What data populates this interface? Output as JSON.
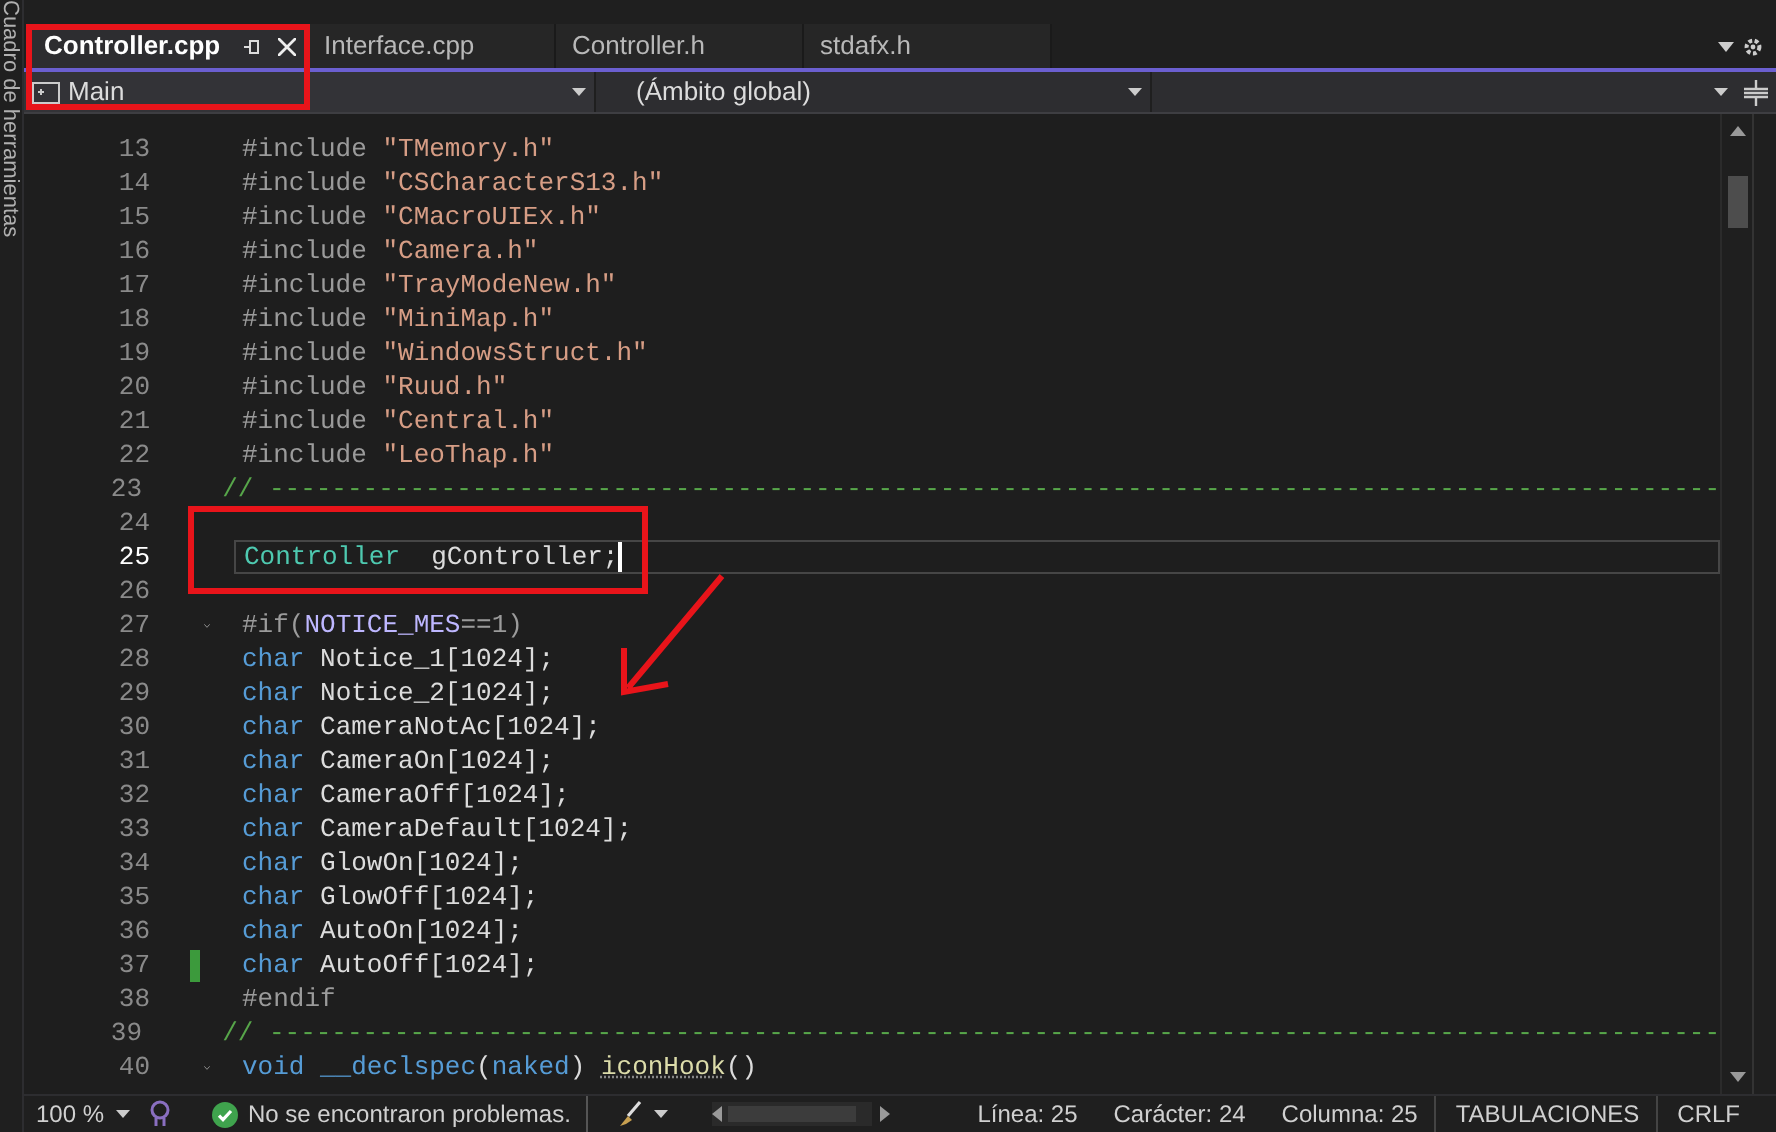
{
  "side_panel": {
    "label": "Cuadro de herramientas"
  },
  "tabs": [
    {
      "label": "Controller.cpp",
      "selected": true
    },
    {
      "label": "Interface.cpp",
      "selected": false
    },
    {
      "label": "Controller.h",
      "selected": false
    },
    {
      "label": "stdafx.h",
      "selected": false
    }
  ],
  "nav_bar": {
    "project": "Main",
    "scope": "(Ámbito global)"
  },
  "code_lines": [
    {
      "number": "13",
      "current": false,
      "foldable": false,
      "changed": false,
      "tokens": [
        {
          "kind": "preproc",
          "text": "#include "
        },
        {
          "kind": "string",
          "text": "\"TMemory.h\""
        }
      ]
    },
    {
      "number": "14",
      "current": false,
      "foldable": false,
      "changed": false,
      "tokens": [
        {
          "kind": "preproc",
          "text": "#include "
        },
        {
          "kind": "string",
          "text": "\"CSCharacterS13.h\""
        }
      ]
    },
    {
      "number": "15",
      "current": false,
      "foldable": false,
      "changed": false,
      "tokens": [
        {
          "kind": "preproc",
          "text": "#include "
        },
        {
          "kind": "string",
          "text": "\"CMacroUIEx.h\""
        }
      ]
    },
    {
      "number": "16",
      "current": false,
      "foldable": false,
      "changed": false,
      "tokens": [
        {
          "kind": "preproc",
          "text": "#include "
        },
        {
          "kind": "string",
          "text": "\"Camera.h\""
        }
      ]
    },
    {
      "number": "17",
      "current": false,
      "foldable": false,
      "changed": false,
      "tokens": [
        {
          "kind": "preproc",
          "text": "#include "
        },
        {
          "kind": "string",
          "text": "\"TrayModeNew.h\""
        }
      ]
    },
    {
      "number": "18",
      "current": false,
      "foldable": false,
      "changed": false,
      "tokens": [
        {
          "kind": "preproc",
          "text": "#include "
        },
        {
          "kind": "string",
          "text": "\"MiniMap.h\""
        }
      ]
    },
    {
      "number": "19",
      "current": false,
      "foldable": false,
      "changed": false,
      "tokens": [
        {
          "kind": "preproc",
          "text": "#include "
        },
        {
          "kind": "string",
          "text": "\"WindowsStruct.h\""
        }
      ]
    },
    {
      "number": "20",
      "current": false,
      "foldable": false,
      "changed": false,
      "tokens": [
        {
          "kind": "preproc",
          "text": "#include "
        },
        {
          "kind": "string",
          "text": "\"Ruud.h\""
        }
      ]
    },
    {
      "number": "21",
      "current": false,
      "foldable": false,
      "changed": false,
      "tokens": [
        {
          "kind": "preproc",
          "text": "#include "
        },
        {
          "kind": "string",
          "text": "\"Central.h\""
        }
      ]
    },
    {
      "number": "22",
      "current": false,
      "foldable": false,
      "changed": false,
      "tokens": [
        {
          "kind": "preproc",
          "text": "#include "
        },
        {
          "kind": "string",
          "text": "\"LeoThap.h\""
        }
      ]
    },
    {
      "number": "23",
      "current": false,
      "foldable": false,
      "changed": false,
      "tokens": [
        {
          "kind": "comment",
          "text": "// ---------------------------------------------------------------------------------------------"
        }
      ]
    },
    {
      "number": "24",
      "current": false,
      "foldable": false,
      "changed": false
    },
    {
      "number": "25",
      "current": true,
      "foldable": false,
      "changed": false,
      "tokens": [
        {
          "kind": "type",
          "text": "Controller"
        },
        {
          "kind": "plain",
          "text": "  gController;"
        }
      ]
    },
    {
      "number": "26",
      "current": false,
      "foldable": false,
      "changed": false
    },
    {
      "number": "27",
      "current": false,
      "foldable": true,
      "changed": false,
      "tokens": [
        {
          "kind": "preproc",
          "text": "#if("
        },
        {
          "kind": "macro",
          "text": "NOTICE_MES"
        },
        {
          "kind": "preproc",
          "text": "==1)"
        }
      ]
    },
    {
      "number": "28",
      "current": false,
      "foldable": false,
      "changed": false,
      "tokens": [
        {
          "kind": "keyword",
          "text": "char"
        },
        {
          "kind": "plain",
          "text": " Notice_1[1024];"
        }
      ]
    },
    {
      "number": "29",
      "current": false,
      "foldable": false,
      "changed": false,
      "tokens": [
        {
          "kind": "keyword",
          "text": "char"
        },
        {
          "kind": "plain",
          "text": " Notice_2[1024];"
        }
      ]
    },
    {
      "number": "30",
      "current": false,
      "foldable": false,
      "changed": false,
      "tokens": [
        {
          "kind": "keyword",
          "text": "char"
        },
        {
          "kind": "plain",
          "text": " CameraNotAc[1024];"
        }
      ]
    },
    {
      "number": "31",
      "current": false,
      "foldable": false,
      "changed": false,
      "tokens": [
        {
          "kind": "keyword",
          "text": "char"
        },
        {
          "kind": "plain",
          "text": " CameraOn[1024];"
        }
      ]
    },
    {
      "number": "32",
      "current": false,
      "foldable": false,
      "changed": false,
      "tokens": [
        {
          "kind": "keyword",
          "text": "char"
        },
        {
          "kind": "plain",
          "text": " CameraOff[1024];"
        }
      ]
    },
    {
      "number": "33",
      "current": false,
      "foldable": false,
      "changed": false,
      "tokens": [
        {
          "kind": "keyword",
          "text": "char"
        },
        {
          "kind": "plain",
          "text": " CameraDefault[1024];"
        }
      ]
    },
    {
      "number": "34",
      "current": false,
      "foldable": false,
      "changed": false,
      "tokens": [
        {
          "kind": "keyword",
          "text": "char"
        },
        {
          "kind": "plain",
          "text": " GlowOn[1024];"
        }
      ]
    },
    {
      "number": "35",
      "current": false,
      "foldable": false,
      "changed": false,
      "tokens": [
        {
          "kind": "keyword",
          "text": "char"
        },
        {
          "kind": "plain",
          "text": " GlowOff[1024];"
        }
      ]
    },
    {
      "number": "36",
      "current": false,
      "foldable": false,
      "changed": false,
      "tokens": [
        {
          "kind": "keyword",
          "text": "char"
        },
        {
          "kind": "plain",
          "text": " AutoOn[1024];"
        }
      ]
    },
    {
      "number": "37",
      "current": false,
      "foldable": false,
      "changed": true,
      "tokens": [
        {
          "kind": "keyword",
          "text": "char"
        },
        {
          "kind": "plain",
          "text": " AutoOff[1024];"
        }
      ]
    },
    {
      "number": "38",
      "current": false,
      "foldable": false,
      "changed": false,
      "tokens": [
        {
          "kind": "preproc",
          "text": "#endif"
        }
      ]
    },
    {
      "number": "39",
      "current": false,
      "foldable": false,
      "changed": false,
      "tokens": [
        {
          "kind": "comment",
          "text": "// ---------------------------------------------------------------------------------------------"
        }
      ]
    },
    {
      "number": "40",
      "current": false,
      "foldable": true,
      "changed": false,
      "tokens": [
        {
          "kind": "keyword",
          "text": "void __declspec"
        },
        {
          "kind": "plain",
          "text": "("
        },
        {
          "kind": "keyword",
          "text": "naked"
        },
        {
          "kind": "plain",
          "text": ") "
        },
        {
          "kind": "function",
          "text": "iconHook"
        },
        {
          "kind": "plain",
          "text": "()"
        }
      ]
    }
  ],
  "status_bar": {
    "zoom": "100 %",
    "issues": "No se encontraron problemas.",
    "line": "Línea: 25",
    "character": "Carácter: 24",
    "column": "Columna: 25",
    "indent": "TABULACIONES",
    "line_ending": "CRLF"
  }
}
